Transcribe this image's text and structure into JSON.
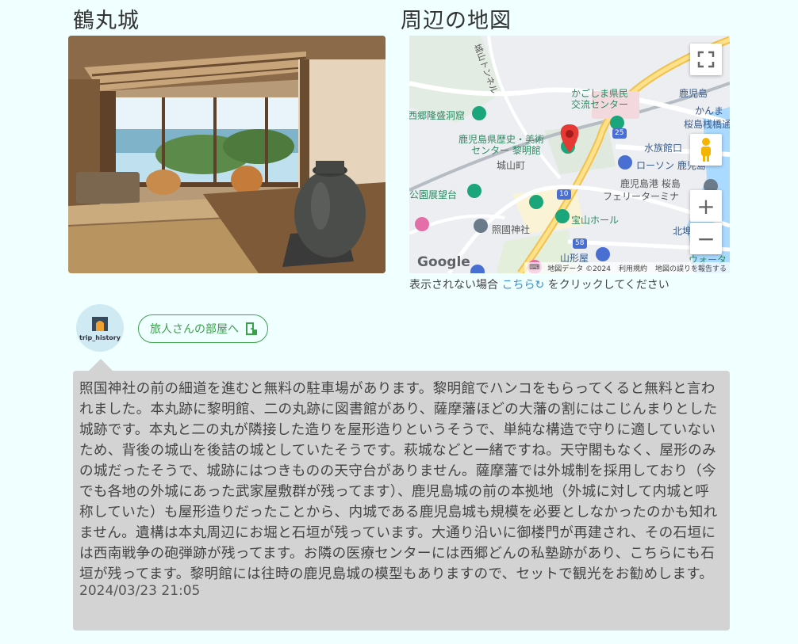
{
  "spot": {
    "title": "鶴丸城"
  },
  "map": {
    "heading": "周辺の地図",
    "labels": {
      "tunnel": "城山トンネル",
      "prefhall": "かごしま県民",
      "prefhall2": "交流センター",
      "kagoshimaeki": "鹿児島",
      "kanma": "かんま",
      "sakurajima_pier": "桜島桟橋通",
      "saigo_cave": "西郷隆盛洞窟",
      "museum": "鹿児島県歴史・美術",
      "museum2": "センター 黎明館",
      "suizokukan": "水族館口",
      "shiroyama": "城山町",
      "lawson": "ローソン 鹿児島",
      "port": "鹿児島港 桜島",
      "ferry": "フェリーターミナ",
      "park": "公園展望台",
      "hall": "宝山ホール",
      "shokoku": "照國神社",
      "kitafuto": "北埠",
      "yamakataya": "山形屋",
      "water": "ウォータ",
      "r10": "10",
      "r25": "25",
      "r58": "58"
    },
    "google": "Google",
    "attribution": "地図データ ©2024",
    "terms": "利用規約",
    "report": "地図の誤りを報告する",
    "zoom_in": "+",
    "zoom_out": "−"
  },
  "map_note": {
    "before": "表示されない場合",
    "link": "こちら",
    "after": "をクリックしてください"
  },
  "user": {
    "avatar_text": "trip_history",
    "room_link": "旅人さんの部屋へ"
  },
  "review": {
    "text": "照国神社の前の細道を進むと無料の駐車場があります。黎明館でハンコをもらってくると無料と言われました。本丸跡に黎明館、二の丸跡に図書館があり、薩摩藩ほどの大藩の割にはこじんまりとした城跡です。本丸と二の丸が隣接した造りを屋形造りというそうで、単純な構造で守りに適していないため、背後の城山を後詰の城としていたそうです。萩城などと一緒ですね。天守閣もなく、屋形のみの城だったそうで、城跡にはつきものの天守台がありません。薩摩藩では外城制を採用しており（今でも各地の外城にあった武家屋敷群が残ってます）、鹿児島城の前の本拠地（外城に対して内城と呼称していた）も屋形造りだったことから、内城である鹿児島城も規模を必要としなかったのかも知れません。遺構は本丸周辺にお堀と石垣が残っています。大通り沿いに御楼門が再建され、その石垣には西南戦争の砲弾跡が残ってます。お隣の医療センターには西郷どんの私塾跡があり、こちらにも石垣が残ってます。黎明館には往時の鹿児島城の模型もありますので、セットで観光をお勧めします。",
    "date": "2024/03/23 21:05"
  },
  "colors": {
    "background": "#f0ffff",
    "accent_green": "#3aa14a",
    "link_blue": "#3b8fd6",
    "bubble": "#d3d3d3",
    "pin_red": "#e53935"
  }
}
